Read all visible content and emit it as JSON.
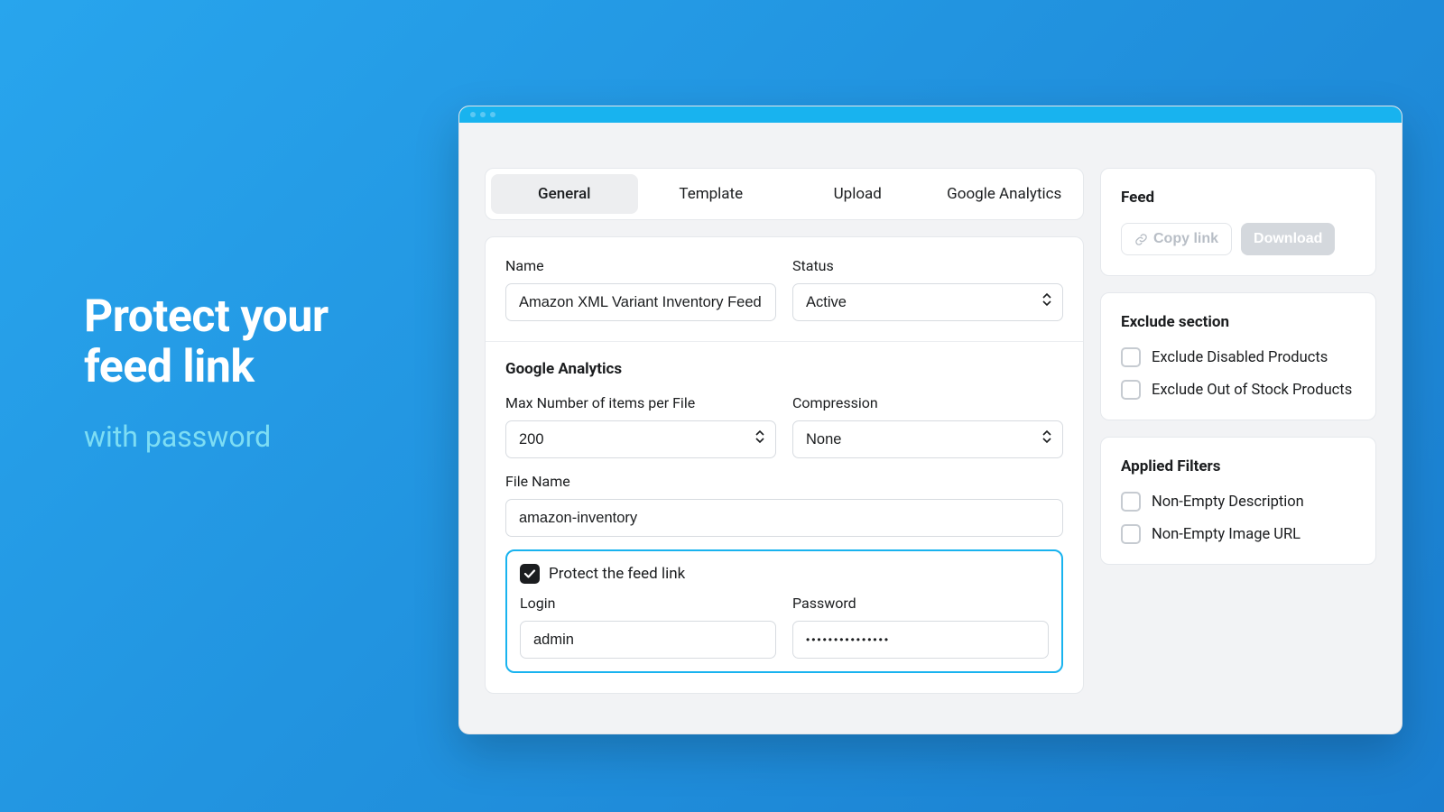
{
  "marketing": {
    "headline_l1": "Protect your",
    "headline_l2": "feed link",
    "sub": "with password"
  },
  "tabs": {
    "general": "General",
    "template": "Template",
    "upload": "Upload",
    "analytics": "Google Analytics"
  },
  "form": {
    "name_label": "Name",
    "name_value": "Amazon XML Variant Inventory Feed",
    "status_label": "Status",
    "status_value": "Active",
    "ga_heading": "Google Analytics",
    "max_items_label": "Max Number of items per File",
    "max_items_value": "200",
    "compression_label": "Compression",
    "compression_value": "None",
    "filename_label": "File Name",
    "filename_value": "amazon-inventory",
    "protect_label": "Protect the feed link",
    "login_label": "Login",
    "login_value": "admin",
    "password_label": "Password",
    "password_value": "•••••••••••••••"
  },
  "aside": {
    "feed_heading": "Feed",
    "copy_link": "Copy link",
    "download": "Download",
    "exclude_heading": "Exclude section",
    "exclude_disabled": "Exclude Disabled Products",
    "exclude_oos": "Exclude Out of Stock Products",
    "filters_heading": "Applied Filters",
    "filter_desc": "Non-Empty Description",
    "filter_img": "Non-Empty Image URL"
  }
}
